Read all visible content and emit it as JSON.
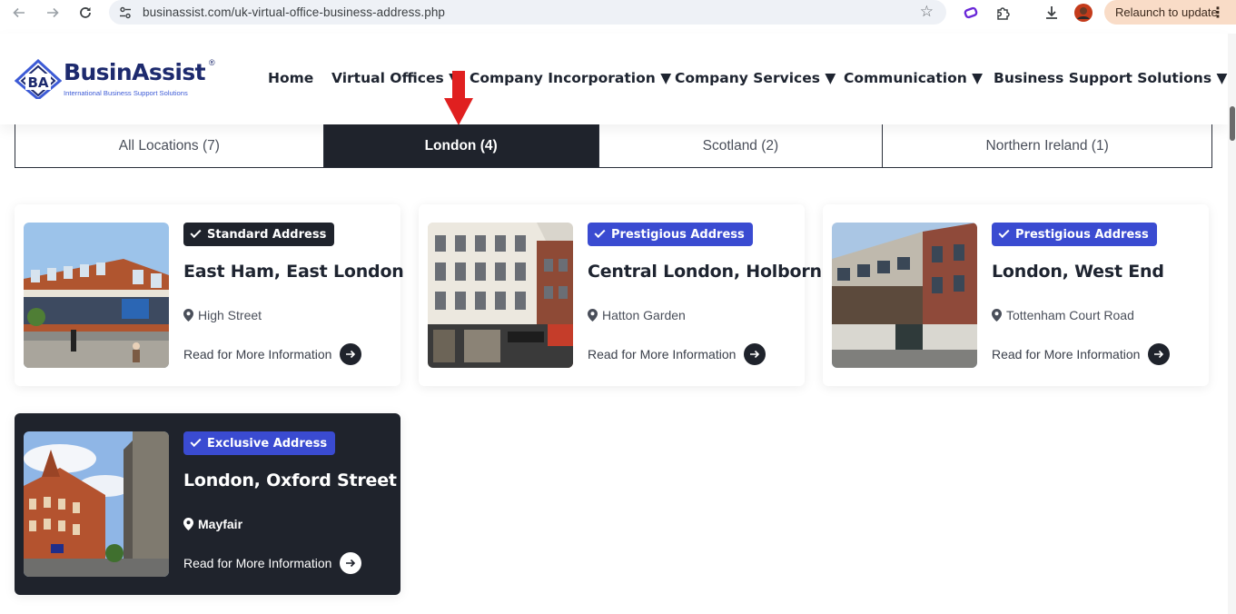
{
  "browser": {
    "url": "businassist.com/uk-virtual-office-business-address.php",
    "relaunch_label": "Relaunch to update"
  },
  "site": {
    "logo": {
      "brand": "BusinAssist",
      "registered": "®",
      "mark": "BA",
      "tagline": "International Business Support Solutions"
    },
    "nav": [
      {
        "label": "Home"
      },
      {
        "label": "Virtual Offices ▼"
      },
      {
        "label": "Company Incorporation ▼"
      },
      {
        "label": "Company Services ▼"
      },
      {
        "label": "Communication ▼"
      },
      {
        "label": "Business Support Solutions ▼"
      }
    ]
  },
  "filters": {
    "active_index": 1,
    "tabs": [
      {
        "label": "All Locations (7)"
      },
      {
        "label": "London (4)"
      },
      {
        "label": "Scotland (2)"
      },
      {
        "label": "Northern Ireland (1)"
      }
    ]
  },
  "cards": [
    {
      "badge": "Standard Address",
      "title": "East Ham, East London",
      "area": "High Street",
      "link": "Read for More Information"
    },
    {
      "badge": "Prestigious Address",
      "title": "Central London, Holborn",
      "area": "Hatton Garden",
      "link": "Read for More Information"
    },
    {
      "badge": "Prestigious Address",
      "title": "London, West End",
      "area": "Tottenham Court Road",
      "link": "Read for More Information"
    },
    {
      "badge": "Exclusive Address",
      "title": "London, Oxford Street",
      "area": "Mayfair",
      "link": "Read for More Information"
    }
  ],
  "colors": {
    "dark": "#1f232c",
    "accent_blue": "#3a4bd1",
    "brand_navy": "#1d2a6e",
    "annotation_red": "#e02020"
  },
  "icons": [
    "back-icon",
    "forward-icon",
    "reload-icon",
    "site-settings-icon",
    "bookmark-star-icon",
    "extension-icon",
    "puzzle-icon",
    "download-icon",
    "profile-avatar",
    "menu-dots-icon",
    "map-pin-icon",
    "arrow-right-icon",
    "checkmark-icon"
  ]
}
